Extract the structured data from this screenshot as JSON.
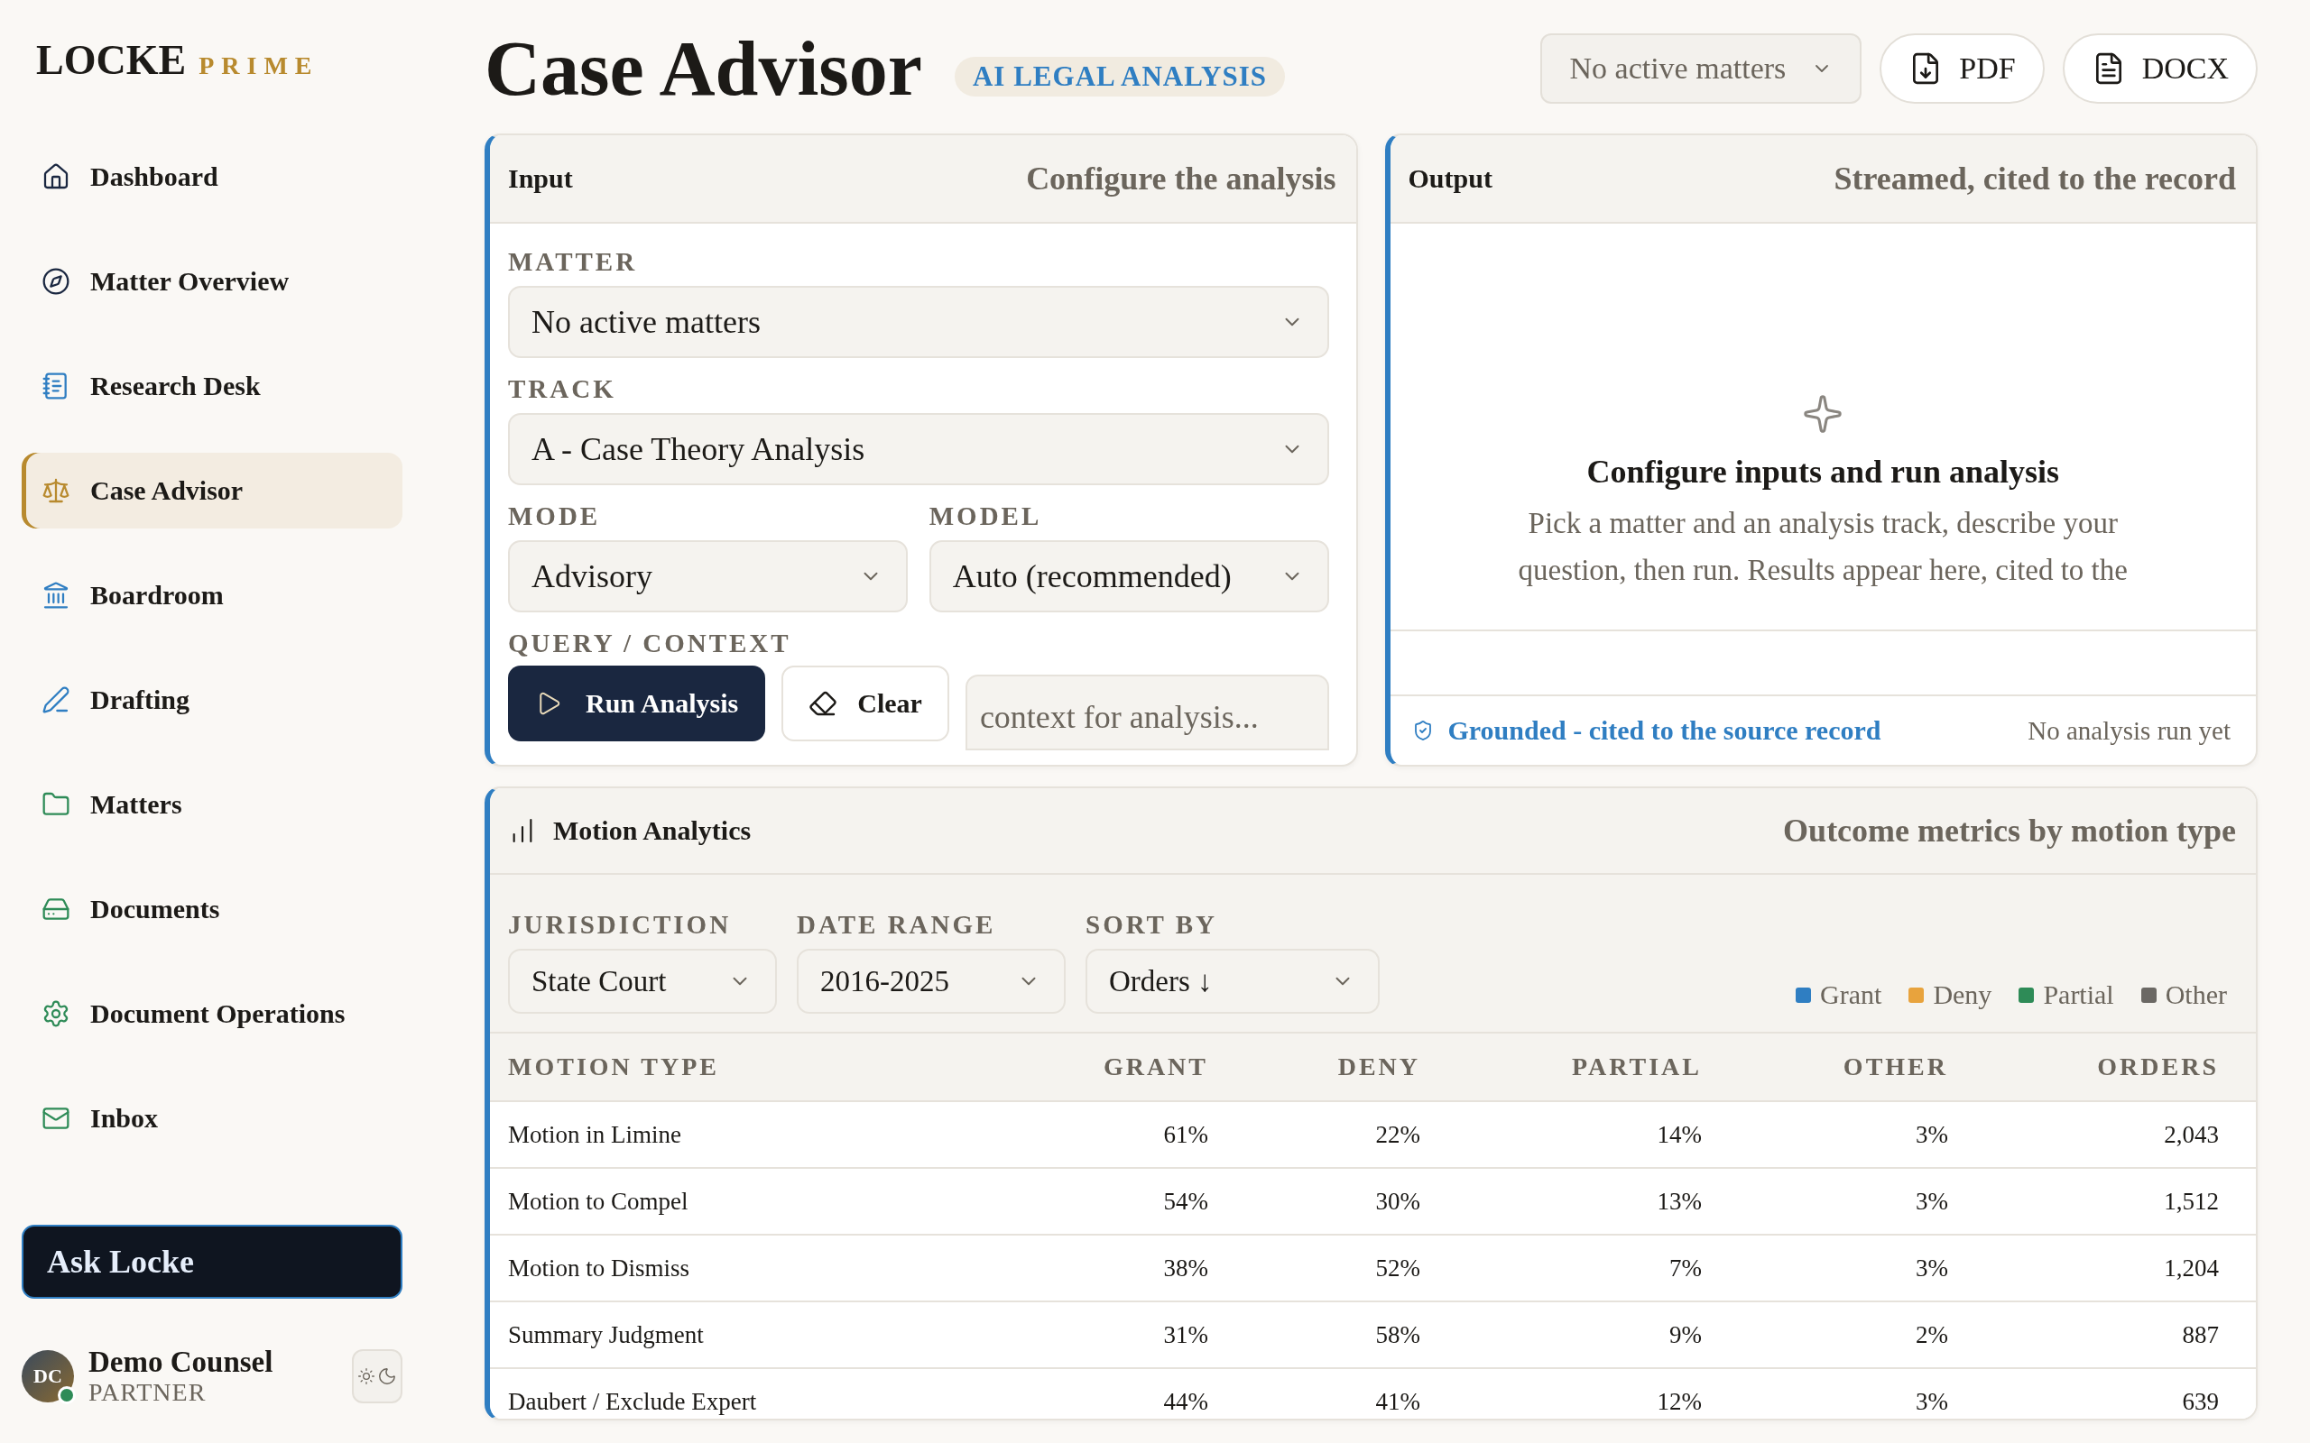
{
  "sidebar": {
    "brand": "LOCKE",
    "brand_suffix": "PRIME",
    "items": [
      {
        "label": "Dashboard",
        "selected": false
      },
      {
        "label": "Matter Overview",
        "selected": false
      },
      {
        "label": "Research Desk",
        "selected": false
      },
      {
        "label": "Case Advisor",
        "selected": true
      },
      {
        "label": "Boardroom",
        "selected": false
      },
      {
        "label": "Drafting",
        "selected": false
      },
      {
        "label": "Matters",
        "selected": false
      },
      {
        "label": "Documents",
        "selected": false
      },
      {
        "label": "Document Operations",
        "selected": false
      },
      {
        "label": "Inbox",
        "selected": false
      }
    ],
    "ask_button": "Ask Locke",
    "user": {
      "initials": "DC",
      "name": "Demo Counsel",
      "role": "PARTNER",
      "online": true
    }
  },
  "header": {
    "title": "Case Advisor",
    "badge": "AI LEGAL ANALYSIS",
    "matter_select": "No active matters",
    "export_buttons": [
      "PDF",
      "DOCX"
    ]
  },
  "input_panel": {
    "title": "Input",
    "subtitle": "Configure the analysis",
    "fields": [
      {
        "label": "MATTER",
        "value": "No active matters"
      },
      {
        "label": "TRACK",
        "value": "A - Case Theory Analysis"
      }
    ],
    "pair": [
      {
        "label": "MODE",
        "value": "Advisory"
      },
      {
        "label": "MODEL",
        "value": "Auto (recommended)"
      }
    ],
    "query": {
      "label": "QUERY / CONTEXT",
      "placeholder": "context for analysis..."
    },
    "run_button": "Run Analysis",
    "clear_button": "Clear"
  },
  "output_panel": {
    "title": "Output",
    "subtitle": "Streamed, cited to the record",
    "empty_title": "Configure inputs and run analysis",
    "empty_text": "Pick a matter and an analysis track, describe your question, then run. Results appear here, cited to the",
    "grounded": "Grounded - cited to the source record",
    "status": "No analysis run yet"
  },
  "analytics": {
    "title": "Motion Analytics",
    "subtitle": "Outcome metrics by motion type",
    "filters": [
      {
        "label": "JURISDICTION",
        "value": "State Court"
      },
      {
        "label": "DATE RANGE",
        "value": "2016-2025"
      },
      {
        "label": "SORT BY",
        "value": "Orders ↓"
      }
    ],
    "legend": [
      {
        "label": "Grant",
        "color": "#2f7ec2"
      },
      {
        "label": "Deny",
        "color": "#e8a33d"
      },
      {
        "label": "Partial",
        "color": "#2e8b57"
      },
      {
        "label": "Other",
        "color": "#6b6864"
      }
    ],
    "columns": [
      "MOTION TYPE",
      "GRANT",
      "DENY",
      "PARTIAL",
      "OTHER",
      "ORDERS"
    ],
    "rows": [
      [
        "Motion in Limine",
        "61%",
        "22%",
        "14%",
        "3%",
        "2,043"
      ],
      [
        "Motion to Compel",
        "54%",
        "30%",
        "13%",
        "3%",
        "1,512"
      ],
      [
        "Motion to Dismiss",
        "38%",
        "52%",
        "7%",
        "3%",
        "1,204"
      ],
      [
        "Summary Judgment",
        "31%",
        "58%",
        "9%",
        "2%",
        "887"
      ],
      [
        "Daubert / Exclude Expert",
        "44%",
        "41%",
        "12%",
        "3%",
        "639"
      ]
    ]
  }
}
